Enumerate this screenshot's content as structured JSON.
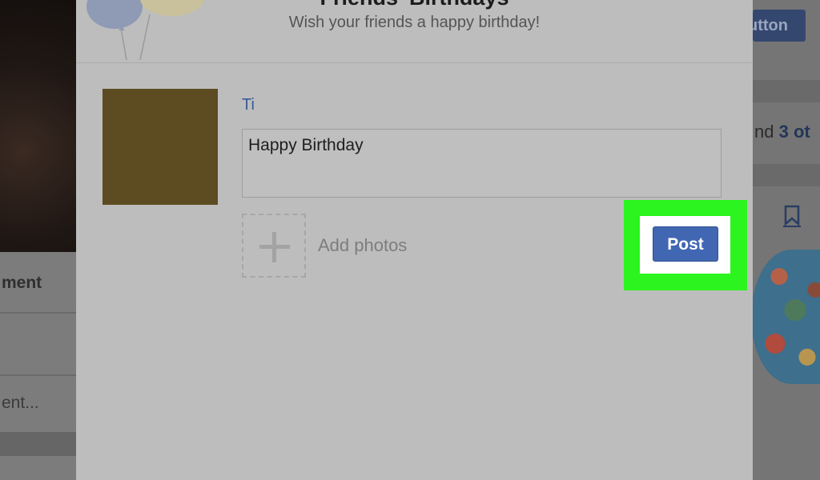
{
  "background": {
    "left_heading": "ment",
    "left_comment_placeholder": "ent...",
    "right_button_label": "utton",
    "right_text_prefix": "nd ",
    "right_text_bold": "3 ot"
  },
  "dialog": {
    "title": "Friends' Birthdays",
    "subtitle": "Wish your friends a happy birthday!",
    "friend_name": "Ti",
    "message_value": "Happy Birthday",
    "add_photos_label": "Add photos",
    "post_label": "Post"
  },
  "colors": {
    "post_button": "#4267b2",
    "highlight": "#2bf41e",
    "friend_name": "#3b5998"
  }
}
